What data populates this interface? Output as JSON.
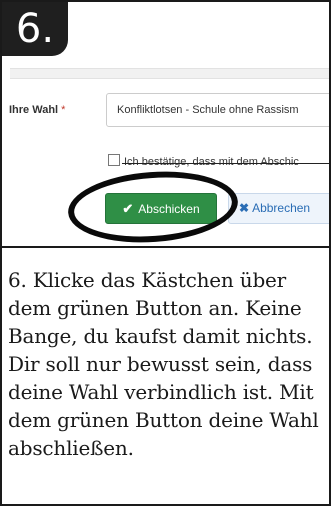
{
  "step": {
    "number": "6."
  },
  "form": {
    "choice_label": "Ihre Wahl",
    "required_marker": "*",
    "choice_value": "Konfliktlotsen - Schule ohne Rassism",
    "confirm_text": "Ich bestätige, dass mit dem Abschic",
    "submit_label": "Abschicken",
    "cancel_label": "Abbrechen"
  },
  "icons": {
    "submit": "check-icon",
    "cancel": "x-icon"
  },
  "colors": {
    "submit_bg": "#2f8f46",
    "cancel_text": "#2a6db5",
    "badge_bg": "#1f1f1f",
    "highlight_ring": "#0a0a0a"
  },
  "instruction": {
    "text": "6. Klicke das Kästchen über dem grünen Button an. Keine Bange, du kaufst damit nichts. Dir soll nur bewusst sein, dass deine Wahl verbindlich ist. Mit dem grünen Button deine Wahl abschließen."
  }
}
